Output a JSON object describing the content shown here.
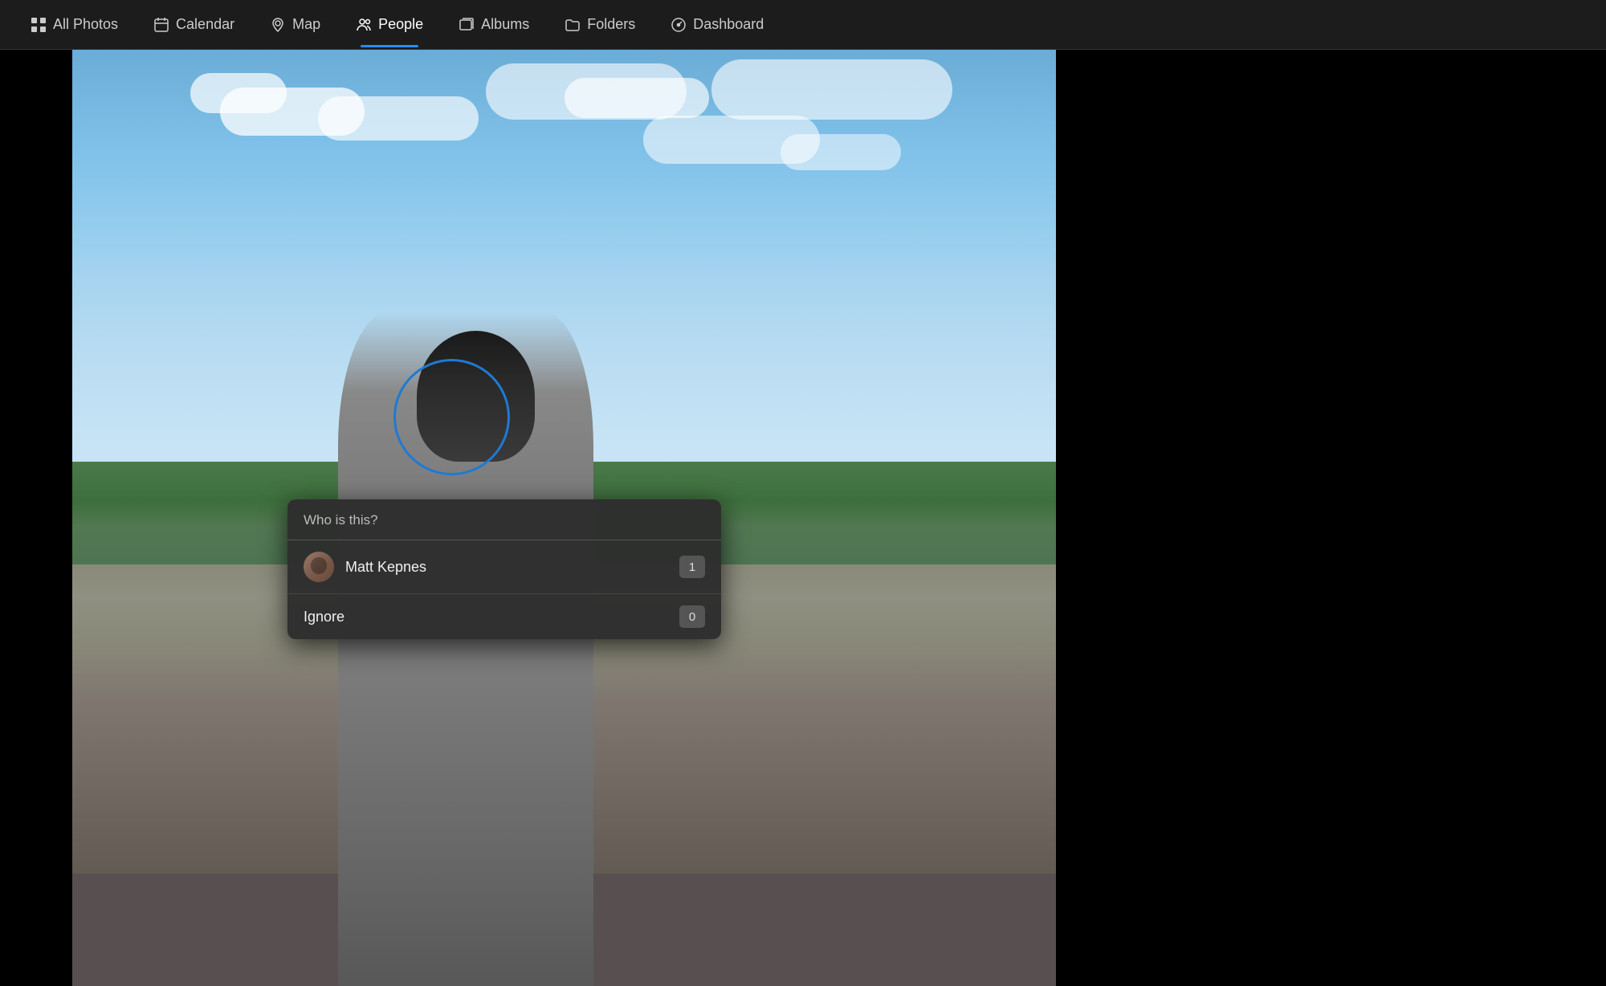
{
  "nav": {
    "items": [
      {
        "id": "all-photos",
        "label": "All Photos",
        "icon": "grid-icon",
        "active": false
      },
      {
        "id": "calendar",
        "label": "Calendar",
        "icon": "calendar-icon",
        "active": false
      },
      {
        "id": "map",
        "label": "Map",
        "icon": "map-icon",
        "active": false
      },
      {
        "id": "people",
        "label": "People",
        "icon": "people-icon",
        "active": true
      },
      {
        "id": "albums",
        "label": "Albums",
        "icon": "albums-icon",
        "active": false
      },
      {
        "id": "folders",
        "label": "Folders",
        "icon": "folders-icon",
        "active": false
      },
      {
        "id": "dashboard",
        "label": "Dashboard",
        "icon": "dashboard-icon",
        "active": false
      }
    ]
  },
  "popup": {
    "title": "Who is this?",
    "people": [
      {
        "name": "Matt Kepnes",
        "count": "1"
      }
    ],
    "ignore_label": "Ignore",
    "ignore_count": "0"
  },
  "colors": {
    "active_underline": "#2a8aff",
    "face_circle": "#1e7ad4",
    "popup_bg": "#2d2d2d"
  }
}
